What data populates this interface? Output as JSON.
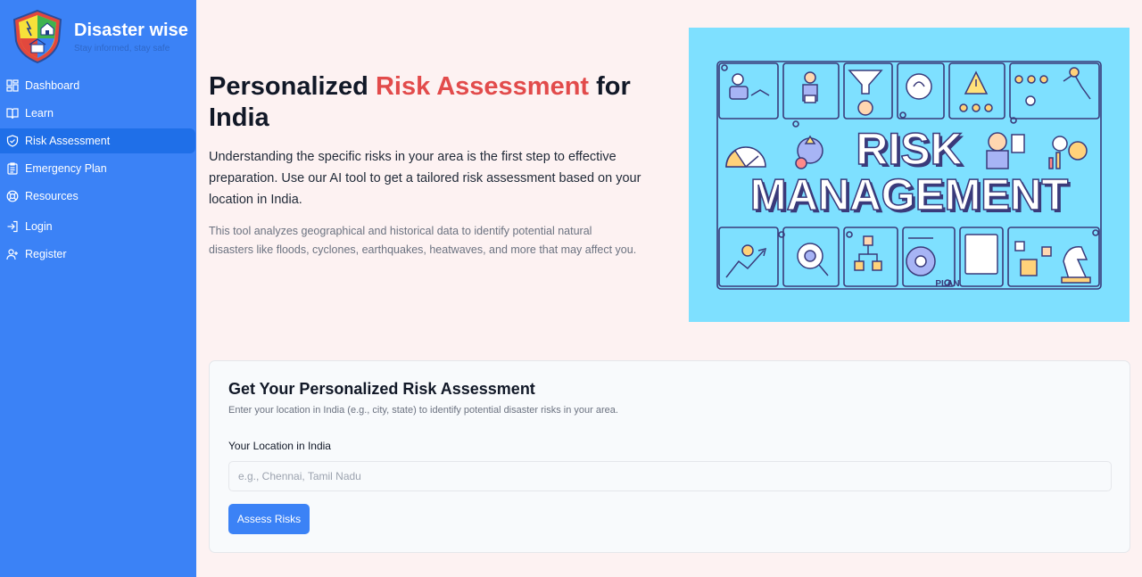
{
  "brand": {
    "name": "Disaster wise",
    "tagline": "Stay informed, stay safe"
  },
  "nav": {
    "items": [
      {
        "label": "Dashboard",
        "icon": "grid-icon"
      },
      {
        "label": "Learn",
        "icon": "book-icon"
      },
      {
        "label": "Risk Assessment",
        "icon": "shield-icon",
        "active": true
      },
      {
        "label": "Emergency Plan",
        "icon": "clipboard-icon"
      },
      {
        "label": "Resources",
        "icon": "lifebuoy-icon"
      },
      {
        "label": "Login",
        "icon": "login-icon"
      },
      {
        "label": "Register",
        "icon": "user-plus-icon"
      }
    ]
  },
  "hero": {
    "title_prefix": "Personalized",
    "title_accent": "Risk Assessment",
    "title_suffix": "for India",
    "description": "Understanding the specific risks in your area is the first step to effective preparation. Use our AI tool to get a tailored risk assessment based on your location in India.",
    "note": "This tool analyzes geographical and historical data to identify potential natural disasters like floods, cyclones, earthquakes, heatwaves, and more that may affect you."
  },
  "illustration": {
    "line1": "RISK",
    "line2": "MANAGEMENT",
    "plan_label": "PLAN"
  },
  "form": {
    "title": "Get Your Personalized Risk Assessment",
    "subtitle": "Enter your location in India (e.g., city, state) to identify potential disaster risks in your area.",
    "location_label": "Your Location in India",
    "location_placeholder": "e.g., Chennai, Tamil Nadu",
    "location_value": "",
    "submit_label": "Assess Risks"
  },
  "colors": {
    "sidebar": "#3b82f6",
    "sidebar_active": "#1f6fe8",
    "accent": "#e24b4b",
    "page_bg": "#fdf2f2",
    "illustration_bg": "#7ee0ff"
  }
}
